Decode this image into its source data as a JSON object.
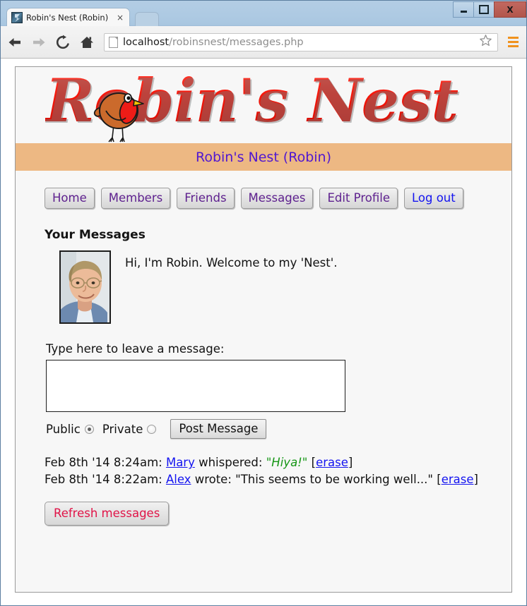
{
  "browser": {
    "tab_title": "Robin's Nest (Robin)",
    "tab_close_label": "×",
    "url_host": "localhost",
    "url_path": "/robinsnest/messages.php",
    "back_icon": "back-arrow-icon",
    "forward_icon": "forward-arrow-icon",
    "reload_icon": "reload-icon",
    "home_icon": "home-icon",
    "bookmark_icon": "star-icon",
    "menu_icon": "hamburger-menu-icon",
    "minimize_label": "",
    "maximize_label": "",
    "close_label": "X"
  },
  "site": {
    "logo_text": "Robin's Nest",
    "logo_color": "#f0170b",
    "banner_color": "#edb883",
    "subbanner_text": "Robin's Nest (Robin)",
    "subbanner_color": "#5017d1"
  },
  "nav": {
    "items": [
      {
        "label": "Home",
        "state": "visited"
      },
      {
        "label": "Members",
        "state": "visited"
      },
      {
        "label": "Friends",
        "state": "visited"
      },
      {
        "label": "Messages",
        "state": "visited"
      },
      {
        "label": "Edit Profile",
        "state": "visited"
      },
      {
        "label": "Log out",
        "state": "unvisited"
      }
    ]
  },
  "main": {
    "section_title": "Your Messages",
    "greeting": "Hi, I'm Robin. Welcome to my 'Nest'.",
    "avatar_alt": "Robin profile photo"
  },
  "form": {
    "label": "Type here to leave a message:",
    "textarea_value": "",
    "textarea_placeholder": "",
    "public_label": "Public",
    "private_label": "Private",
    "public_selected": true,
    "private_selected": false,
    "post_button": "Post Message"
  },
  "messages": [
    {
      "timestamp": "Feb 8th '14 8:24am:",
      "author": "Mary",
      "verb": " whispered: ",
      "body": "\"Hiya!\"",
      "private": true,
      "erase_open": " [",
      "erase_label": "erase",
      "erase_close": "]"
    },
    {
      "timestamp": "Feb 8th '14 8:22am:",
      "author": "Alex",
      "verb": " wrote: ",
      "body": "\"This seems to be working well...\"",
      "private": false,
      "erase_open": " [",
      "erase_label": "erase",
      "erase_close": "]"
    }
  ],
  "footer": {
    "refresh_button": "Refresh messages",
    "refresh_color": "#e01347"
  }
}
